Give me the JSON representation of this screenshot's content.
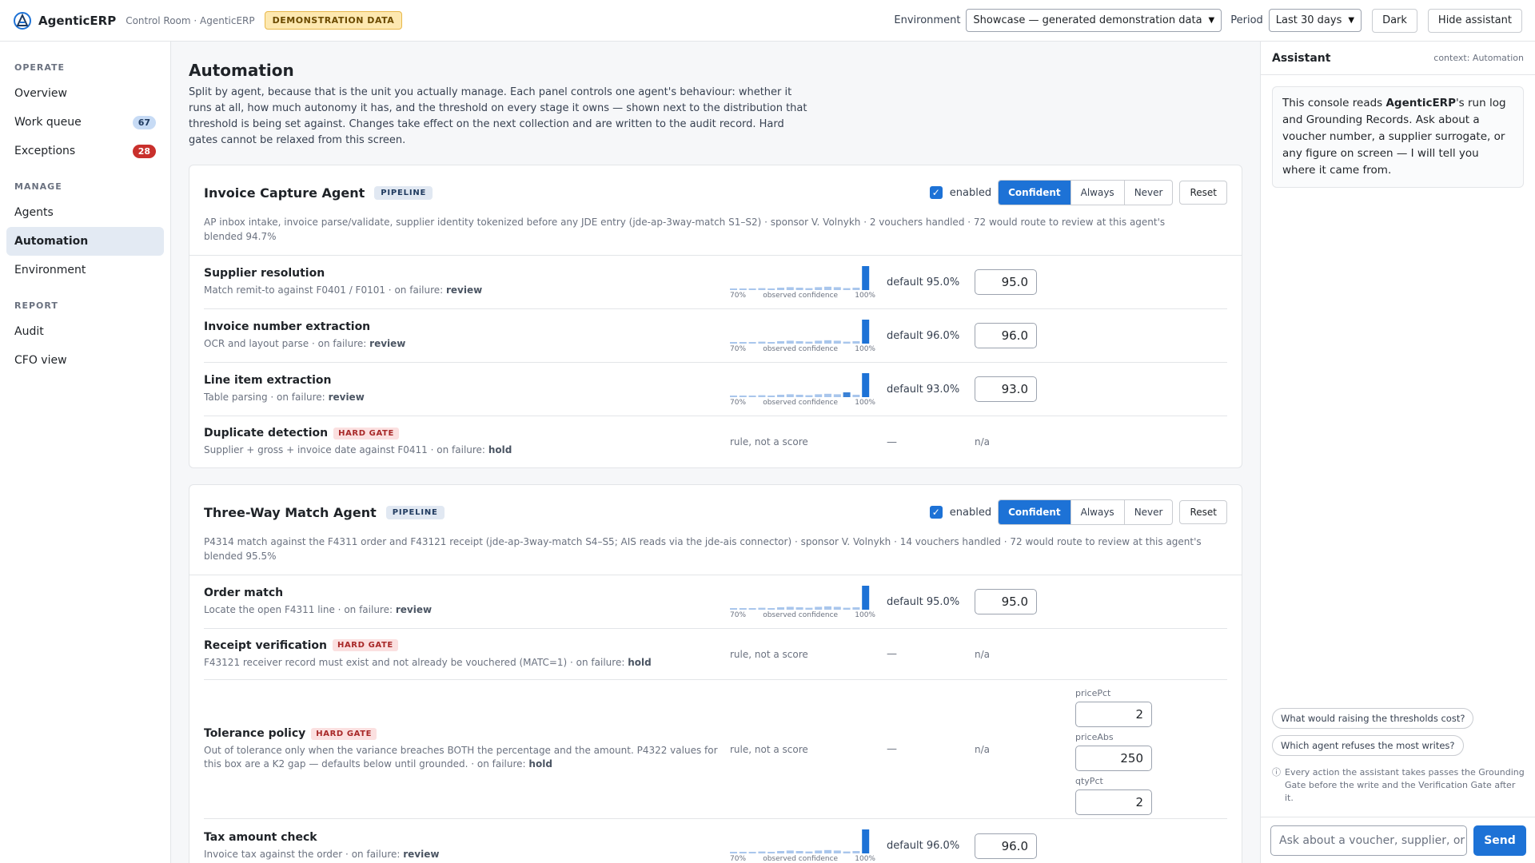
{
  "topbar": {
    "brand": "AgenticERP",
    "crumb": "Control Room · AgenticERP",
    "badge": "DEMONSTRATION DATA",
    "env_label": "Environment",
    "env_value": "Showcase — generated demonstration data",
    "period_label": "Period",
    "period_value": "Last 30 days",
    "dark_btn": "Dark",
    "hide_btn": "Hide assistant"
  },
  "sidebar": {
    "sections": [
      {
        "title": "OPERATE",
        "items": [
          {
            "label": "Overview"
          },
          {
            "label": "Work queue",
            "count": "67",
            "tone": "blue"
          },
          {
            "label": "Exceptions",
            "count": "28",
            "tone": "red"
          }
        ]
      },
      {
        "title": "MANAGE",
        "items": [
          {
            "label": "Agents"
          },
          {
            "label": "Automation",
            "active": true
          },
          {
            "label": "Environment"
          }
        ]
      },
      {
        "title": "REPORT",
        "items": [
          {
            "label": "Audit"
          },
          {
            "label": "CFO view"
          }
        ]
      }
    ]
  },
  "main": {
    "title": "Automation",
    "intro": "Split by agent, because that is the unit you actually manage. Each panel controls one agent's behaviour: whether it runs at all, how much autonomy it has, and the threshold on every stage it owns — shown next to the distribution that threshold is being set against. Changes take effect on the next collection and are written to the audit record. Hard gates cannot be relaxed from this screen.",
    "hist_labels": {
      "low": "70%",
      "mid": "observed confidence",
      "high": "100%"
    },
    "enabled_label": "enabled",
    "modes": [
      "Confident",
      "Always",
      "Never"
    ],
    "reset_label": "Reset",
    "rule_text": "rule, not a score",
    "dash": "—",
    "na": "n/a",
    "gate_label": "HARD GATE",
    "failure_prefix": "on failure:",
    "agents": [
      {
        "name": "Invoice Capture Agent",
        "pill": "PIPELINE",
        "desc": "AP inbox intake, invoice parse/validate, supplier identity tokenized before any JDE entry (jde-ap-3way-match S1–S2) · sponsor V. Volnykh · 2 vouchers handled · 72 would route to review at this agent's blended 94.7%",
        "stages": [
          {
            "name": "Supplier resolution",
            "sub": "Match remit-to against F0401 / F0101 ·",
            "failure": "review",
            "default": "default 95.0%",
            "value": "95.0",
            "hist": [
              0.05,
              0.05,
              0.05,
              0.08,
              0.06,
              0.1,
              0.12,
              0.1,
              0.08,
              0.12,
              0.14,
              0.12,
              0.08,
              0.1,
              1.0
            ]
          },
          {
            "name": "Invoice number extraction",
            "sub": "OCR and layout parse ·",
            "failure": "review",
            "default": "default 96.0%",
            "value": "96.0",
            "hist": [
              0.05,
              0.05,
              0.05,
              0.08,
              0.06,
              0.1,
              0.12,
              0.1,
              0.08,
              0.12,
              0.14,
              0.12,
              0.08,
              0.1,
              1.0
            ]
          },
          {
            "name": "Line item extraction",
            "sub": "Table parsing ·",
            "failure": "review",
            "default": "default 93.0%",
            "value": "93.0",
            "hist": [
              0.05,
              0.05,
              0.05,
              0.08,
              0.06,
              0.1,
              0.12,
              0.1,
              0.08,
              0.12,
              0.14,
              0.12,
              0.2,
              0.1,
              1.0
            ]
          },
          {
            "name": "Duplicate detection",
            "gate": true,
            "sub": "Supplier + gross + invoice date against F0411 ·",
            "failure": "hold"
          }
        ]
      },
      {
        "name": "Three-Way Match Agent",
        "pill": "PIPELINE",
        "desc": "P4314 match against the F4311 order and F43121 receipt (jde-ap-3way-match S4–S5; AIS reads via the jde-ais connector) · sponsor V. Volnykh · 14 vouchers handled · 72 would route to review at this agent's blended 95.5%",
        "stages": [
          {
            "name": "Order match",
            "sub": "Locate the open F4311 line ·",
            "failure": "review",
            "default": "default 95.0%",
            "value": "95.0",
            "hist": [
              0.05,
              0.05,
              0.05,
              0.08,
              0.06,
              0.1,
              0.12,
              0.1,
              0.08,
              0.12,
              0.14,
              0.12,
              0.08,
              0.1,
              1.0
            ]
          },
          {
            "name": "Receipt verification",
            "gate": true,
            "sub": "F43121 receiver record must exist and not already be vouchered (MATC=1) ·",
            "failure": "hold"
          },
          {
            "name": "Tolerance policy",
            "gate": true,
            "sub": "Out of tolerance only when the variance breaches BOTH the percentage and the amount. P4322 values for this box are a K2 gap — defaults below until grounded. ·",
            "failure": "hold",
            "tolerance": [
              {
                "label": "pricePct",
                "value": "2"
              },
              {
                "label": "priceAbs",
                "value": "250"
              },
              {
                "label": "qtyPct",
                "value": "2"
              }
            ]
          },
          {
            "name": "Tax amount check",
            "sub": "Invoice tax against the order ·",
            "failure": "review",
            "default": "default 96.0%",
            "value": "96.0",
            "hist": [
              0.05,
              0.05,
              0.05,
              0.08,
              0.06,
              0.1,
              0.12,
              0.1,
              0.08,
              0.12,
              0.14,
              0.12,
              0.08,
              0.1,
              1.0
            ]
          }
        ]
      }
    ]
  },
  "assistant": {
    "title": "Assistant",
    "context": "context: Automation",
    "msg_pre": "This console reads ",
    "msg_bold": "AgenticERP",
    "msg_post": "'s run log and Grounding Records. Ask about a voucher number, a supplier surrogate, or any figure on screen — I will tell you where it came from.",
    "suggestions": [
      "What would raising the thresholds cost?",
      "Which agent refuses the most writes?"
    ],
    "note": "Every action the assistant takes passes the Grounding Gate before the write and the Verification Gate after it.",
    "input_placeholder": "Ask about a voucher, supplier, or figure…",
    "send": "Send"
  },
  "colors": {
    "accent": "#1d72d6",
    "bar_light": "#a9c6ec",
    "bar_strong": "#1d72d6",
    "gate": "#a82828"
  }
}
